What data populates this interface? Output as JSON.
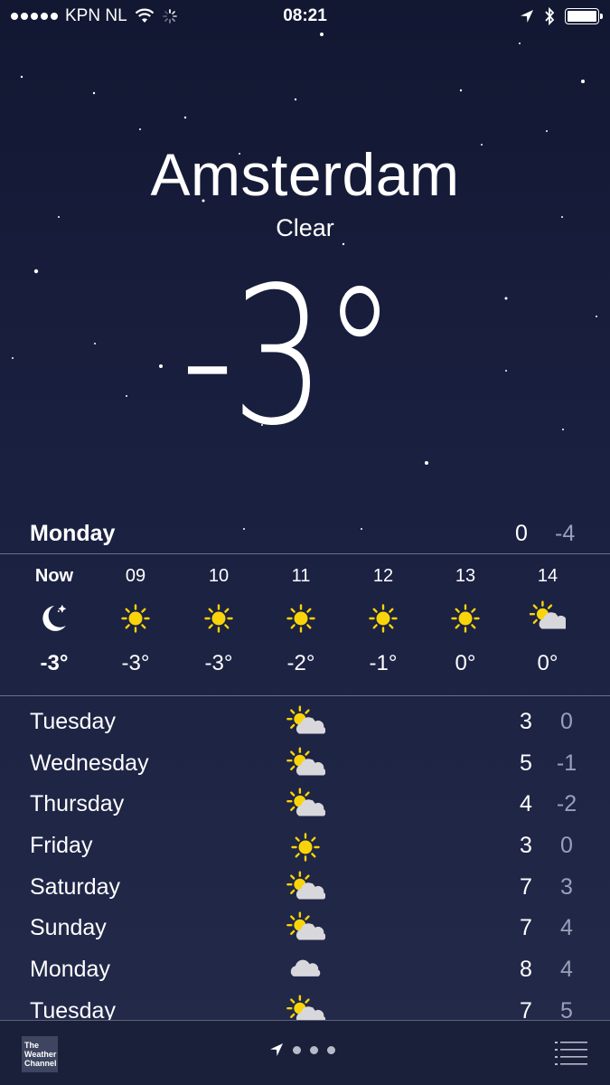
{
  "status_bar": {
    "carrier": "KPN NL",
    "time": "08:21",
    "battery_level": 1.0
  },
  "weather": {
    "city": "Amsterdam",
    "condition": "Clear",
    "temperature": "-3°"
  },
  "today": {
    "day": "Monday",
    "high": "0",
    "low": "-4"
  },
  "hourly": [
    {
      "label": "Now",
      "icon": "moon-stars-icon",
      "temp": "-3°"
    },
    {
      "label": "09",
      "icon": "sun-icon",
      "temp": "-3°"
    },
    {
      "label": "10",
      "icon": "sun-icon",
      "temp": "-3°"
    },
    {
      "label": "11",
      "icon": "sun-icon",
      "temp": "-2°"
    },
    {
      "label": "12",
      "icon": "sun-icon",
      "temp": "-1°"
    },
    {
      "label": "13",
      "icon": "sun-icon",
      "temp": "0°"
    },
    {
      "label": "14",
      "icon": "partly-cloudy-icon",
      "temp": "0°"
    }
  ],
  "daily": [
    {
      "day": "Tuesday",
      "icon": "partly-cloudy-icon",
      "high": "3",
      "low": "0"
    },
    {
      "day": "Wednesday",
      "icon": "partly-cloudy-icon",
      "high": "5",
      "low": "-1"
    },
    {
      "day": "Thursday",
      "icon": "partly-cloudy-icon",
      "high": "4",
      "low": "-2"
    },
    {
      "day": "Friday",
      "icon": "sun-icon",
      "high": "3",
      "low": "0"
    },
    {
      "day": "Saturday",
      "icon": "partly-cloudy-icon",
      "high": "7",
      "low": "3"
    },
    {
      "day": "Sunday",
      "icon": "partly-cloudy-icon",
      "high": "7",
      "low": "4"
    },
    {
      "day": "Monday",
      "icon": "cloud-icon",
      "high": "8",
      "low": "4"
    },
    {
      "day": "Tuesday",
      "icon": "partly-cloudy-icon",
      "high": "7",
      "low": "5"
    }
  ],
  "footer": {
    "logo_text": "The Weather Channel",
    "page_count": 3
  },
  "colors": {
    "background_top": "#121832",
    "background_bottom": "#242a4a",
    "sun": "#f9d40a",
    "cloud": "#d8d8dc",
    "secondary_text": "#9aa0b8"
  }
}
